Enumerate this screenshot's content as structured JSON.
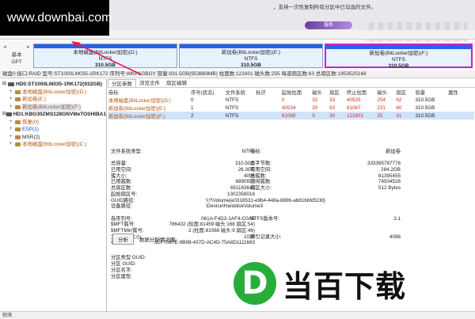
{
  "watermark": "www.downbai.com",
  "top_hint": "，支持一次性复制所有分区中已勾选的文件。",
  "top_badge": "服务",
  "menu": [
    "...",
    "...",
    "...",
    "..."
  ],
  "disk_label": {
    "line1": "基本",
    "line2": "GPT",
    "nav_left": "◄",
    "nav_right": "►"
  },
  "disk_partitions": [
    {
      "name": "本地磁盘(BitLocker加密)(D:)",
      "fs": "NTFS",
      "size": "310.5GB",
      "selected": false
    },
    {
      "name": "新加卷(BitLocker加密)(E:)",
      "fs": "NTFS",
      "size": "310.5GB",
      "selected": false
    },
    {
      "name": "新加卷(BitLocker加密)(F:)",
      "fs": "NTFS",
      "size": "310.5GB",
      "selected": true
    }
  ],
  "info_line": "磁盘0 接口:RAID  型号:ST1000LM035-1RK172  序列号:WKP1GBGY  容量:931.5GB(953869MB)  柱面数:121601  磁头数:255  每道扇区数:63  总扇区数:1953525168",
  "tree": [
    {
      "label": "HD0:ST1000LM035-1RK172(932GB)",
      "level": 0,
      "type": "disk",
      "expanded": true
    },
    {
      "label": "本地磁盘(BitLocker加密)(D:)",
      "level": 1,
      "type": "part",
      "color": "orange"
    },
    {
      "label": "新加卷(E:)",
      "level": 1,
      "type": "part",
      "color": "orange"
    },
    {
      "label": "新加卷(BitLocker加密)(F:)",
      "level": 1,
      "type": "part",
      "color": "orange",
      "selected": true
    },
    {
      "label": "HD1:KBG30ZMS128GNVMeTOSHIBA1",
      "level": 0,
      "type": "disk",
      "expanded": true
    },
    {
      "label": "恢复(0)",
      "level": 1,
      "type": "part",
      "color": "orange"
    },
    {
      "label": "ESP(1)",
      "level": 1,
      "type": "part",
      "color": "blue"
    },
    {
      "label": "MSR(2)",
      "level": 1,
      "type": "part",
      "color": "normal"
    },
    {
      "label": "本地磁盘(BitLocker加密)(C:)",
      "level": 1,
      "type": "part",
      "color": "orange"
    }
  ],
  "tabs": [
    "分区参数",
    "浏览文件",
    "扇区编辑"
  ],
  "table": {
    "headers": [
      "卷标",
      "序号(状态)",
      "文件系统",
      "标识",
      "起始柱面",
      "磁头",
      "扇区",
      "终止柱面",
      "磁头",
      "扇区",
      "容量",
      "属性"
    ],
    "rows": [
      [
        "本地磁盘(BitLocker加密)(D:)",
        "0",
        "NTFS",
        "",
        "0",
        "32",
        "33",
        "40533",
        "254",
        "62",
        "310.5GB",
        ""
      ],
      [
        "新加卷(BitLocker加密)(E:)",
        "1",
        "NTFS",
        "",
        "40534",
        "20",
        "63",
        "81067",
        "231",
        "60",
        "310.5GB",
        ""
      ],
      [
        "新加卷(BitLocker加密)(F:)",
        "2",
        "NTFS",
        "",
        "81068",
        "9",
        "30",
        "121601",
        "25",
        "31",
        "310.5GB",
        ""
      ]
    ]
  },
  "details": {
    "fs_type_label": "文件系统类型:",
    "fs_type": "NTFS",
    "vol_label": "卷标:",
    "vol": "新加卷",
    "rows": [
      [
        "总容量:",
        "310.5GB",
        "总字节数:",
        "333395787776"
      ],
      [
        "已用空间:",
        "26.3GB",
        "可用空间:",
        "284.2GB"
      ],
      [
        "簇大小:",
        "4096",
        "总簇数:",
        "81395455"
      ],
      [
        "已用簇数:",
        "6890929",
        "空闲簇数:",
        "74504526"
      ],
      [
        "总扇区数:",
        "651163648",
        "扇区大小:",
        "512 Bytes"
      ],
      [
        "起始扇区号:",
        "1302358016",
        "",
        ""
      ]
    ],
    "guid_path_label": "GUID路径:",
    "guid_path": "\\\\?\\Volume{e0318531-e9b4-448a-889b-ab81bbfd51fd}",
    "device_path_label": "设备路径:",
    "device_path": "\\Device\\HarddiskVolume3",
    "rows2": [
      [
        "卷序列号:",
        "061A-F4D3-1AF4-C0AB",
        "NTFS版本号:",
        "3.1"
      ],
      [
        "$MFT簇号:",
        "786432 (柱面:81459 磁头:168 扇区:54)",
        "",
        ""
      ],
      [
        "$MFTMirr簇号:",
        "2 (柱面:81068 磁头:9 扇区:46)",
        "",
        ""
      ],
      [
        "文件记录大小:",
        "1024",
        "索引记录大小:",
        "4096"
      ],
      [
        "卷GUID:",
        "3EF7087E-9B98-437D-AC4D-75A8D1111683",
        "",
        ""
      ]
    ]
  },
  "analyze_button": "分析",
  "analyze_label": "数据分配情况图:",
  "ptype": [
    "分区类型 GUID:",
    "分区 GUID:",
    "分区名字:",
    "分区属性:"
  ],
  "status": "就绪",
  "logo": {
    "mark": "D",
    "text": "当百下载"
  }
}
